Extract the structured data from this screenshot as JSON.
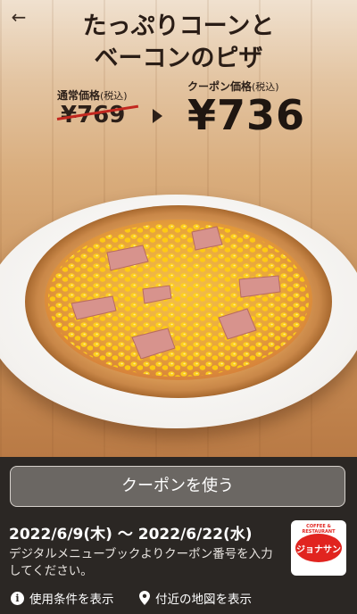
{
  "header": {
    "back_icon": "arrow-left-icon"
  },
  "product": {
    "title_line1": "たっぷりコーンと",
    "title_line2": "ベーコンのピザ",
    "regular_label": "通常価格",
    "regular_tax": "(税込)",
    "regular_price": "¥769",
    "coupon_label": "クーポン価格",
    "coupon_tax": "(税込)",
    "coupon_price": "¥736"
  },
  "coupon": {
    "use_button": "クーポンを使う",
    "period": "2022/6/9(木) 〜 2022/6/22(水)",
    "note": "デジタルメニューブックよりクーポン番号を入力してください。",
    "logo_text": "ジョナサン",
    "logo_top_text": "COFFEE & RESTAURANT"
  },
  "links": {
    "terms": "使用条件を表示",
    "terms_icon": "info-icon",
    "map": "付近の地図を表示",
    "map_icon": "map-pin-icon"
  },
  "colors": {
    "panel_bg": "#2b2724",
    "strike": "#c2271f",
    "logo_red": "#e1241f"
  }
}
